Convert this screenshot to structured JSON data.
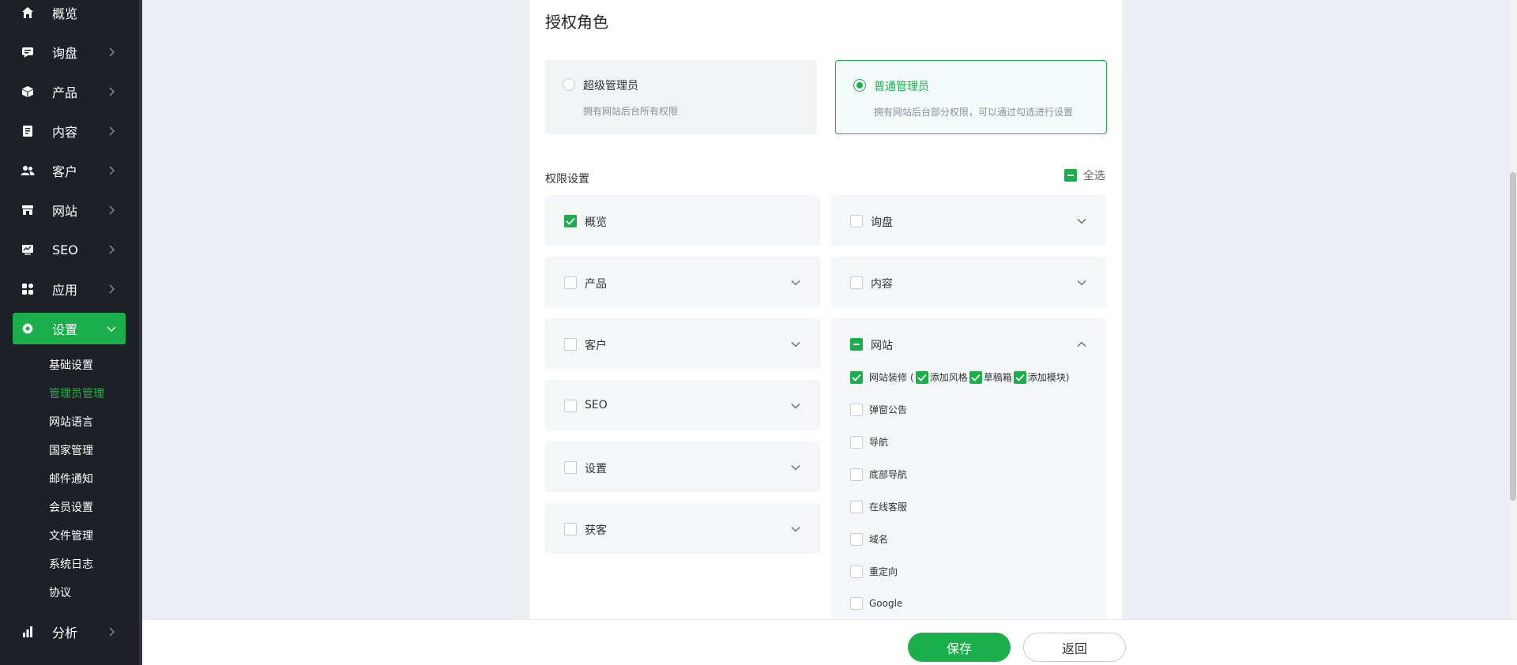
{
  "sidebar": {
    "items": [
      {
        "label": "概览",
        "icon": "home-icon"
      },
      {
        "label": "询盘",
        "icon": "message-icon"
      },
      {
        "label": "产品",
        "icon": "box-icon"
      },
      {
        "label": "内容",
        "icon": "document-icon"
      },
      {
        "label": "客户",
        "icon": "users-icon"
      },
      {
        "label": "网站",
        "icon": "store-icon"
      },
      {
        "label": "SEO",
        "icon": "monitor-chart-icon"
      },
      {
        "label": "应用",
        "icon": "apps-icon"
      },
      {
        "label": "设置",
        "icon": "gear-icon"
      },
      {
        "label": "分析",
        "icon": "bar-chart-icon"
      }
    ],
    "settings_sub": [
      "基础设置",
      "管理员管理",
      "网站语言",
      "国家管理",
      "邮件通知",
      "会员设置",
      "文件管理",
      "系统日志",
      "协议"
    ],
    "active_color": "#1aaf4b"
  },
  "main": {
    "title": "授权角色",
    "roles": [
      {
        "name": "超级管理员",
        "desc": "拥有网站后台所有权限",
        "selected": false
      },
      {
        "name": "普通管理员",
        "desc": "拥有网站后台部分权限，可以通过勾选进行设置",
        "selected": true
      }
    ],
    "perm_label": "权限设置",
    "select_all": "全选",
    "perms": [
      {
        "label": "概览",
        "state": "checked"
      },
      {
        "label": "询盘",
        "state": "unchecked"
      },
      {
        "label": "产品",
        "state": "unchecked"
      },
      {
        "label": "内容",
        "state": "unchecked"
      },
      {
        "label": "客户",
        "state": "unchecked"
      },
      {
        "label": "SEO",
        "state": "unchecked"
      },
      {
        "label": "设置",
        "state": "unchecked"
      },
      {
        "label": "获客",
        "state": "unchecked"
      },
      {
        "label": "网站",
        "state": "indeterminate"
      }
    ],
    "website_items": {
      "decor": {
        "label": "网站装修",
        "open": "(",
        "subs": [
          "添加风格",
          "草稿箱",
          "添加模块"
        ],
        "close": ")"
      },
      "others": [
        "弹窗公告",
        "导航",
        "底部导航",
        "在线客服",
        "域名",
        "重定向",
        "Google"
      ]
    }
  },
  "footer": {
    "save": "保存",
    "back": "返回"
  }
}
